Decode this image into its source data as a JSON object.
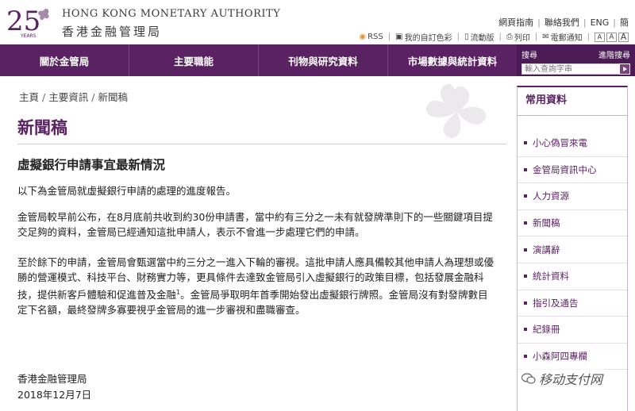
{
  "header": {
    "logo_number": "25",
    "logo_sub": "YEARS",
    "org_name_en": "HONG KONG MONETARY AUTHORITY",
    "org_name_zh": "香港金融管理局",
    "top_links": [
      "網頁指南",
      "聯絡我們",
      "ENG",
      "簡"
    ],
    "tools": {
      "rss": "RSS",
      "my_colors": "我的自訂色彩",
      "mobile": "流動版",
      "print": "列印",
      "email_notify": "電郵通知",
      "font_sizes": [
        "A",
        "A",
        "A"
      ]
    }
  },
  "nav": {
    "items": [
      "關於金管局",
      "主要職能",
      "刊物與研究資料",
      "市場數據與統計資料"
    ]
  },
  "search": {
    "label": "搜尋",
    "advanced": "進階搜尋",
    "placeholder": "輸入查詢字串"
  },
  "breadcrumb": [
    "主頁",
    "主要資訊",
    "新聞稿"
  ],
  "page_title": "新聞稿",
  "article": {
    "title": "虛擬銀行申請事宜最新情況",
    "p1": "以下為金管局就虛擬銀行申請的處理的進度報告。",
    "p2": "金管局較早前公布，在8月底前共收到約30份申請書，當中約有三分之一未有就發牌準則下的一些關鍵項目提交足夠的資料，金管局已經通知這批申請人，表示不會進一步處理它們的申請。",
    "p3a": "至於餘下的申請，金管局會甄選當中約三分之一進入下輪的審視。這批申請人應具備較其他申請人為理想或優勝的營運模式、科技平台、財務實力等，更具條件去達致金管局引入虛擬銀行的政策目標，包括發展金融科技，提供新客戶體驗和促進普及金融",
    "p3_footnote": "1",
    "p3b": "。金管局爭取明年首季開始發出虛擬銀行牌照。金管局沒有對發牌數目定下名額，最終發牌多寡要視乎金管局的進一步審視和盡職審查。",
    "sign_org": "香港金融管理局",
    "sign_date": "2018年12月7日"
  },
  "sidebar": {
    "heading": "常用資料",
    "items": [
      "小心偽冒來電",
      "金管局資訊中心",
      "人力資源",
      "新聞稿",
      "演講辭",
      "統計資料",
      "指引及通告",
      "紀錄冊",
      "小森阿四專欄"
    ]
  },
  "watermark": {
    "text": "移动支付网"
  },
  "colors": {
    "brand_purple": "#5b2263",
    "rss_orange": "#e8912a"
  }
}
